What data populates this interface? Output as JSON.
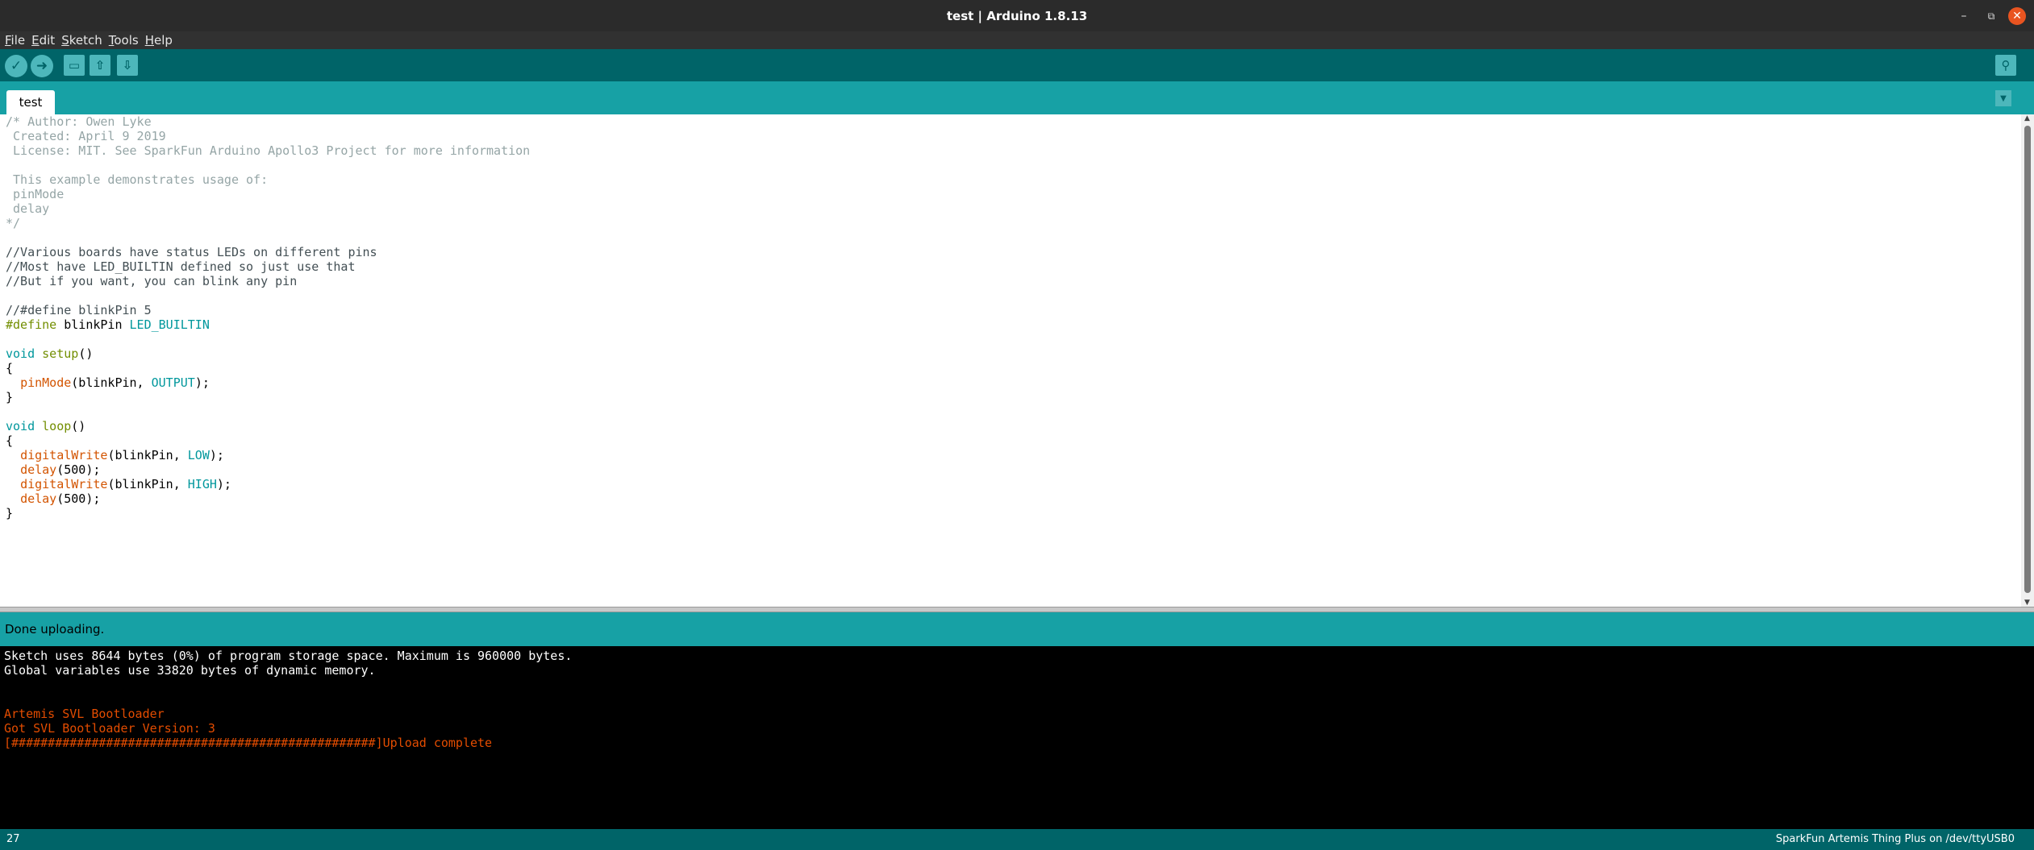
{
  "window": {
    "title": "test | Arduino 1.8.13",
    "controls": {
      "minimize": "–",
      "maximize": "⧉",
      "close": "✕"
    }
  },
  "menu": [
    {
      "label": "File",
      "mnemonic": "F",
      "rest": "ile"
    },
    {
      "label": "Edit",
      "mnemonic": "E",
      "rest": "dit"
    },
    {
      "label": "Sketch",
      "mnemonic": "S",
      "rest": "ketch"
    },
    {
      "label": "Tools",
      "mnemonic": "T",
      "rest": "ools"
    },
    {
      "label": "Help",
      "mnemonic": "H",
      "rest": "elp"
    }
  ],
  "toolbar": {
    "verify_icon": "checkmark-icon",
    "upload_icon": "right-arrow-icon",
    "new_icon": "new-file-icon",
    "open_icon": "open-arrow-up-icon",
    "save_icon": "save-arrow-down-icon",
    "serial_icon": "magnifier-icon",
    "glyphs": {
      "verify": "✓",
      "upload": "➜",
      "new": "▭",
      "open": "⇧",
      "save": "⇩",
      "serial": "⚲"
    }
  },
  "tabs": {
    "active": "test",
    "menu_glyph": "▼"
  },
  "editor": {
    "lines": [
      [
        {
          "t": "/* Author: Owen Lyke",
          "c": "c-comment"
        }
      ],
      [
        {
          "t": " Created: April 9 2019",
          "c": "c-comment"
        }
      ],
      [
        {
          "t": " License: MIT. See SparkFun Arduino Apollo3 Project for more information",
          "c": "c-comment"
        }
      ],
      [
        {
          "t": "",
          "c": "c-comment"
        }
      ],
      [
        {
          "t": " This example demonstrates usage of:",
          "c": "c-comment"
        }
      ],
      [
        {
          "t": " pinMode",
          "c": "c-comment"
        }
      ],
      [
        {
          "t": " delay",
          "c": "c-comment"
        }
      ],
      [
        {
          "t": "*/",
          "c": "c-comment"
        }
      ],
      [
        {
          "t": "",
          "c": "c-plain"
        }
      ],
      [
        {
          "t": "//Various boards have status LEDs on different pins",
          "c": "c-slash"
        }
      ],
      [
        {
          "t": "//Most have LED_BUILTIN defined so just use that",
          "c": "c-slash"
        }
      ],
      [
        {
          "t": "//But if you want, you can blink any pin",
          "c": "c-slash"
        }
      ],
      [
        {
          "t": "",
          "c": "c-plain"
        }
      ],
      [
        {
          "t": "//#define blinkPin 5",
          "c": "c-slash"
        }
      ],
      [
        {
          "t": "#define",
          "c": "c-kw"
        },
        {
          "t": " blinkPin ",
          "c": "c-plain"
        },
        {
          "t": "LED_BUILTIN",
          "c": "c-const"
        }
      ],
      [
        {
          "t": "",
          "c": "c-plain"
        }
      ],
      [
        {
          "t": "void",
          "c": "c-const"
        },
        {
          "t": " ",
          "c": "c-plain"
        },
        {
          "t": "setup",
          "c": "c-kw"
        },
        {
          "t": "()",
          "c": "c-plain"
        }
      ],
      [
        {
          "t": "{",
          "c": "c-plain"
        }
      ],
      [
        {
          "t": "  ",
          "c": "c-plain"
        },
        {
          "t": "pinMode",
          "c": "c-fn"
        },
        {
          "t": "(blinkPin, ",
          "c": "c-plain"
        },
        {
          "t": "OUTPUT",
          "c": "c-const"
        },
        {
          "t": ");",
          "c": "c-plain"
        }
      ],
      [
        {
          "t": "}",
          "c": "c-plain"
        }
      ],
      [
        {
          "t": "",
          "c": "c-plain"
        }
      ],
      [
        {
          "t": "void",
          "c": "c-const"
        },
        {
          "t": " ",
          "c": "c-plain"
        },
        {
          "t": "loop",
          "c": "c-kw"
        },
        {
          "t": "()",
          "c": "c-plain"
        }
      ],
      [
        {
          "t": "{",
          "c": "c-plain"
        }
      ],
      [
        {
          "t": "  ",
          "c": "c-plain"
        },
        {
          "t": "digitalWrite",
          "c": "c-fn"
        },
        {
          "t": "(blinkPin, ",
          "c": "c-plain"
        },
        {
          "t": "LOW",
          "c": "c-const"
        },
        {
          "t": ");",
          "c": "c-plain"
        }
      ],
      [
        {
          "t": "  ",
          "c": "c-plain"
        },
        {
          "t": "delay",
          "c": "c-fn"
        },
        {
          "t": "(500);",
          "c": "c-plain"
        }
      ],
      [
        {
          "t": "  ",
          "c": "c-plain"
        },
        {
          "t": "digitalWrite",
          "c": "c-fn"
        },
        {
          "t": "(blinkPin, ",
          "c": "c-plain"
        },
        {
          "t": "HIGH",
          "c": "c-const"
        },
        {
          "t": ");",
          "c": "c-plain"
        }
      ],
      [
        {
          "t": "  ",
          "c": "c-plain"
        },
        {
          "t": "delay",
          "c": "c-fn"
        },
        {
          "t": "(500);",
          "c": "c-plain"
        }
      ],
      [
        {
          "t": "}",
          "c": "c-plain"
        }
      ]
    ],
    "scroll_up": "▲",
    "scroll_down": "▼"
  },
  "status": {
    "message": "Done uploading."
  },
  "console": {
    "lines": [
      {
        "t": "Sketch uses 8644 bytes (0%) of program storage space. Maximum is 960000 bytes.",
        "c": "con-white"
      },
      {
        "t": "Global variables use 33820 bytes of dynamic memory.",
        "c": "con-white"
      },
      {
        "t": "",
        "c": "con-white"
      },
      {
        "t": "",
        "c": "con-white"
      },
      {
        "t": "Artemis SVL Bootloader",
        "c": "con-orange"
      },
      {
        "t": "Got SVL Bootloader Version: 3",
        "c": "con-orange"
      },
      {
        "t": "[##################################################]Upload complete",
        "c": "con-orange"
      }
    ]
  },
  "footer": {
    "line_number": "27",
    "board_port": "SparkFun Artemis Thing Plus on /dev/ttyUSB0"
  },
  "colors": {
    "toolbar": "#006468",
    "tabbar": "#17a1a5",
    "console_bg": "#000000",
    "console_error": "#e34c00",
    "titlebar": "#2b2b2b",
    "close_button": "#e95420"
  }
}
